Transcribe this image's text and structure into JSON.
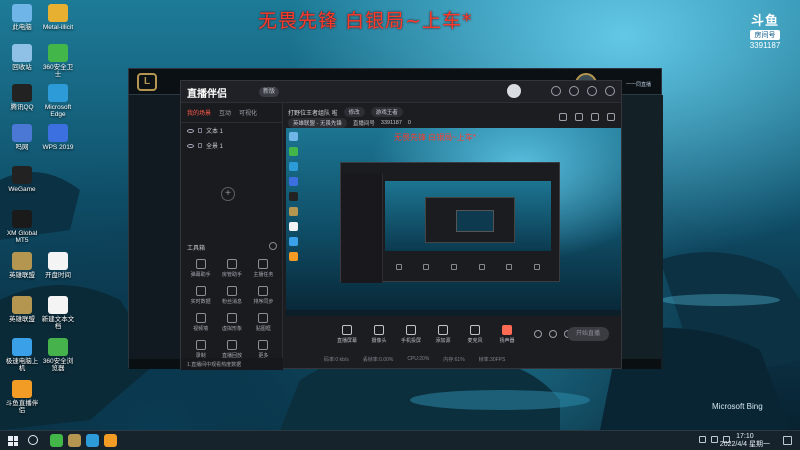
{
  "overlay": {
    "stream_title": "无畏先锋 白银局~上车*",
    "douyu_logo": "斗鱼",
    "douyu_room_label": "房间号",
    "douyu_room_number": "3391187",
    "bing_watermark": "Microsoft Bing"
  },
  "desktop_icons": [
    {
      "label": "此电脑",
      "color": "#6fb5e8"
    },
    {
      "label": "Metal-illicit",
      "color": "#e7b030"
    },
    {
      "label": "回收站",
      "color": "#8fc1e6"
    },
    {
      "label": "360安全卫士",
      "color": "#43b649"
    },
    {
      "label": "腾讯QQ",
      "color": "#222222"
    },
    {
      "label": "Microsoft Edge",
      "color": "#2c9bd8"
    },
    {
      "label": "吗网",
      "color": "#4a78d4"
    },
    {
      "label": "WPS 2019",
      "color": "#3c6fe0"
    },
    {
      "label": "WeGame",
      "color": "#222222"
    },
    {
      "label": "XM Global MT5",
      "color": "#1a1a1a"
    },
    {
      "label": "英雄联盟",
      "color": "#b49650"
    },
    {
      "label": "开盘时间",
      "color": "#f4f4f4"
    },
    {
      "label": "英雄联盟",
      "color": "#b49650"
    },
    {
      "label": "新建文本文档",
      "color": "#f4f4f4"
    },
    {
      "label": "极速电脑上机",
      "color": "#3aa0e8"
    },
    {
      "label": "360安全浏览器",
      "color": "#45b24b"
    },
    {
      "label": "斗鱼直播伴侣",
      "color": "#f29b25"
    }
  ],
  "lol": {
    "logo_letter": "L",
    "chat_label": "一一同直播"
  },
  "app": {
    "logo": "直播伴侣",
    "badge": "新版",
    "tabs": [
      {
        "label": "我的场景",
        "active": true
      },
      {
        "label": "互动",
        "active": false
      },
      {
        "label": "可视化",
        "active": false
      }
    ],
    "scenes": [
      "文本 1",
      "全景 1"
    ],
    "add_scene": "+",
    "tools_title": "工具箱",
    "tools": [
      {
        "label": "弹幕助手"
      },
      {
        "label": "房管助手"
      },
      {
        "label": "主播任务"
      },
      {
        "label": "实时数据"
      },
      {
        "label": "粉丝消息"
      },
      {
        "label": "排序同步"
      },
      {
        "label": "视频墙"
      },
      {
        "label": "虚拟形象"
      },
      {
        "label": "贴图框"
      },
      {
        "label": "录制"
      },
      {
        "label": "直播回放"
      },
      {
        "label": "更多"
      }
    ],
    "notice": "1.直播间中观看热度数据",
    "room_title": "打野位王者组队 啦",
    "edit_label": "修改",
    "category": "游戏王者",
    "room_info": "英雄联盟 - 无畏先锋",
    "room_label": "直播间号",
    "room_number": "3391187",
    "viewer_count": "0",
    "preview_title": "无畏先锋 白银局~上车*",
    "controls": [
      {
        "label": "直播屏幕",
        "key": "screen"
      },
      {
        "label": "摄像头",
        "key": "camera"
      },
      {
        "label": "手机投屏",
        "key": "phone"
      },
      {
        "label": "添加源",
        "key": "source"
      },
      {
        "label": "麦克风",
        "key": "mic"
      },
      {
        "label": "扬声器",
        "key": "speaker"
      }
    ],
    "start_button": "开始直播",
    "stats": [
      "码率:0 kb/s",
      "丢帧率:0.00%",
      "CPU:20%",
      "内存:61%",
      "帧率:30FPS"
    ]
  },
  "taskbar": {
    "time": "17:10",
    "date": "2022/4/4 星期一",
    "apps": [
      {
        "name": "wegame",
        "color": "#43b649"
      },
      {
        "name": "lol",
        "color": "#b49650"
      },
      {
        "name": "edge",
        "color": "#2c9bd8"
      },
      {
        "name": "douyu",
        "color": "#f29b25"
      }
    ]
  }
}
